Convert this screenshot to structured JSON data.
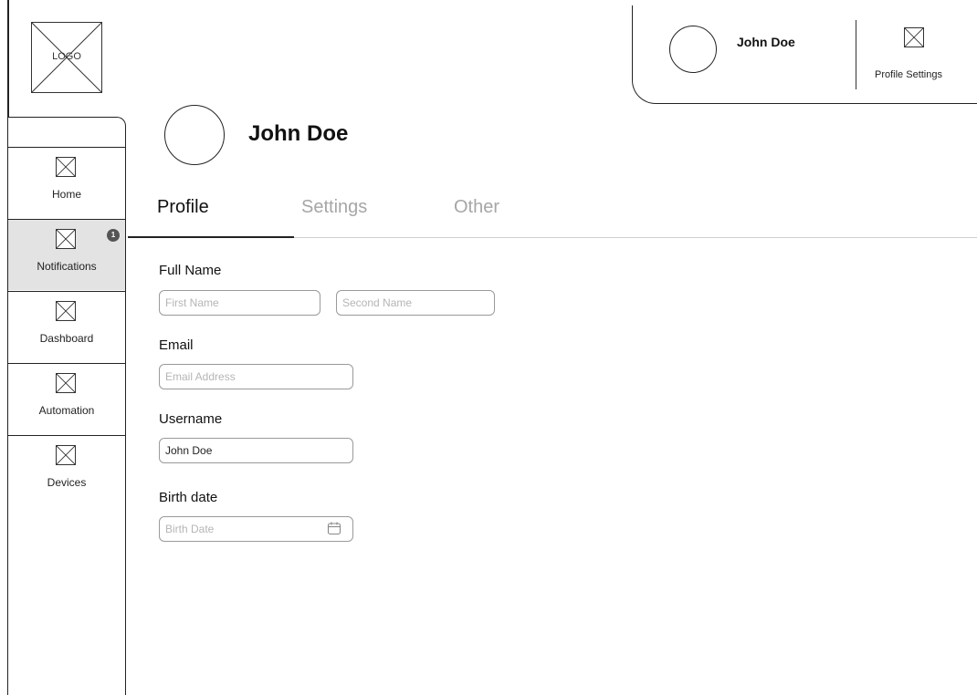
{
  "logo": {
    "text": "LOGO"
  },
  "profile_card": {
    "name": "John Doe",
    "settings_label": "Profile Settings"
  },
  "sidebar": {
    "items": [
      {
        "label": "Home",
        "icon": "home-icon",
        "active": false
      },
      {
        "label": "Notifications",
        "icon": "notifications-icon",
        "active": true,
        "badge": "1"
      },
      {
        "label": "Dashboard",
        "icon": "dashboard-icon",
        "active": false
      },
      {
        "label": "Automation",
        "icon": "automation-icon",
        "active": false
      },
      {
        "label": "Devices",
        "icon": "devices-icon",
        "active": false
      }
    ]
  },
  "header": {
    "name": "John Doe"
  },
  "tabs": [
    {
      "label": "Profile",
      "active": true
    },
    {
      "label": "Settings",
      "active": false
    },
    {
      "label": "Other",
      "active": false
    }
  ],
  "form": {
    "full_name_label": "Full Name",
    "first_name_placeholder": "First Name",
    "second_name_placeholder": "Second Name",
    "email_label": "Email",
    "email_placeholder": "Email Address",
    "username_label": "Username",
    "username_value": "John Doe",
    "birth_date_label": "Birth date",
    "birth_date_placeholder": "Birth Date"
  },
  "colors": {
    "active_nav_bg": "#e3e3e3",
    "inactive_tab": "#a6a6a6",
    "badge_bg": "#555555"
  }
}
